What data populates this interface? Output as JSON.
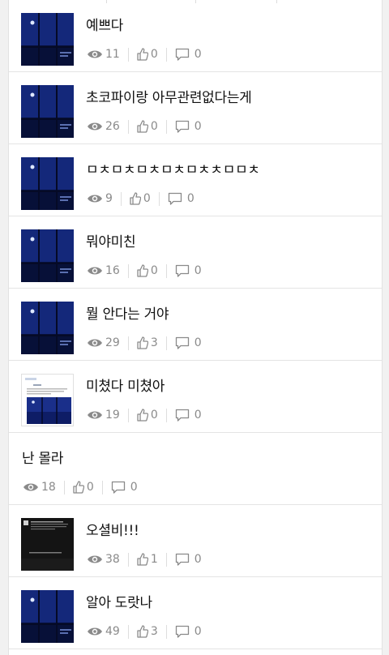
{
  "posts": [
    {
      "title": "예쁘다",
      "views": "11",
      "likes": "0",
      "comments": "0",
      "thumb": "night-window"
    },
    {
      "title": "초코파이랑 아무관련없다는게",
      "views": "26",
      "likes": "0",
      "comments": "0",
      "thumb": "night-window"
    },
    {
      "title": "ㅁㅊㅁㅊㅁㅊㅁㅊㅁㅊㅊㅁㅁㅊ",
      "views": "9",
      "likes": "0",
      "comments": "0",
      "thumb": "night-window"
    },
    {
      "title": "뭐야미친",
      "views": "16",
      "likes": "0",
      "comments": "0",
      "thumb": "night-window"
    },
    {
      "title": "뭘 안다는 거야",
      "views": "29",
      "likes": "3",
      "comments": "0",
      "thumb": "night-window"
    },
    {
      "title": "미쳤다 미쳤아",
      "views": "19",
      "likes": "0",
      "comments": "0",
      "thumb": "document-screenshot"
    },
    {
      "title": "난 몰라",
      "views": "18",
      "likes": "0",
      "comments": "0",
      "thumb": ""
    },
    {
      "title": "오셜비!!!",
      "views": "38",
      "likes": "1",
      "comments": "0",
      "thumb": "dark-notice"
    },
    {
      "title": "알아 도랏나",
      "views": "49",
      "likes": "3",
      "comments": "0",
      "thumb": "night-window"
    }
  ],
  "colors": {
    "meta": "#8a8a8a",
    "thumb_navy": "#0b1440",
    "divider": "#e4e4e4"
  }
}
